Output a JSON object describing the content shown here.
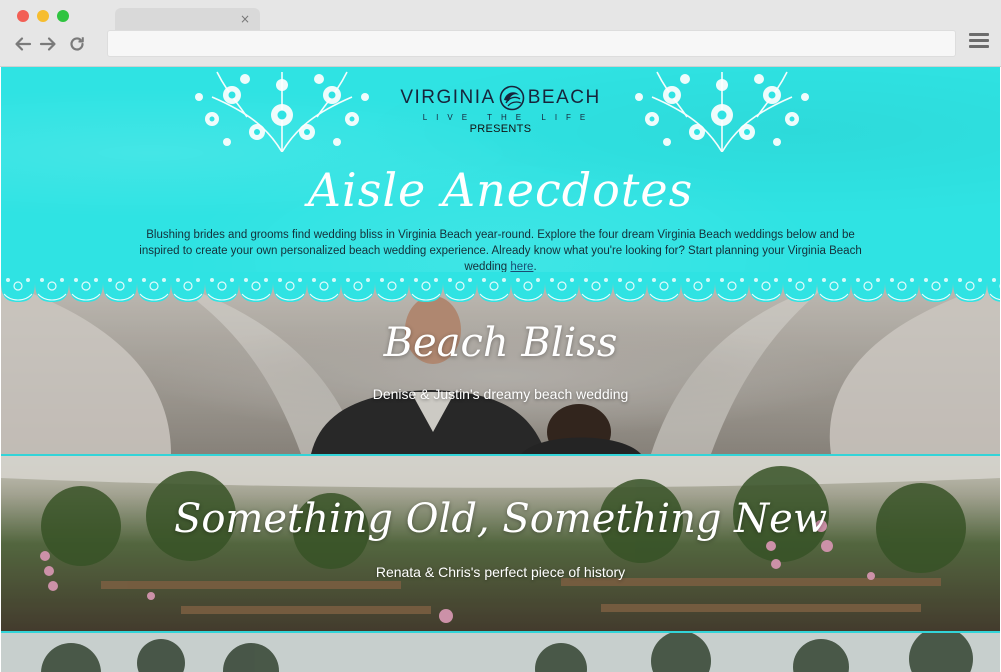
{
  "browser": {
    "tab_close": "×",
    "url": "",
    "icons": [
      "back-icon",
      "forward-icon",
      "reload-icon",
      "menu-icon"
    ]
  },
  "header": {
    "logo_left": "VIRGINIA",
    "logo_right": "BEACH",
    "tagline": "LIVE THE LIFE",
    "presents": "PRESENTS",
    "title": "Aisle Anecdotes",
    "intro": "Blushing brides and grooms find wedding bliss in Virginia Beach year-round. Explore the four dream Virginia Beach weddings below and be inspired to create your own personalized beach wedding experience. Already know what you're looking for? Start planning your Virginia Beach wedding ",
    "link_text": "here",
    "intro_end": "."
  },
  "stories": [
    {
      "title": "Beach Bliss",
      "subtitle": "Denise & Justin's dreamy beach wedding"
    },
    {
      "title": "Something Old, Something New",
      "subtitle": "Renata & Chris's perfect piece of history"
    }
  ],
  "colors": {
    "accent": "#2fe3e3",
    "divider": "#33d4d8",
    "logo_ink": "#17243b"
  }
}
